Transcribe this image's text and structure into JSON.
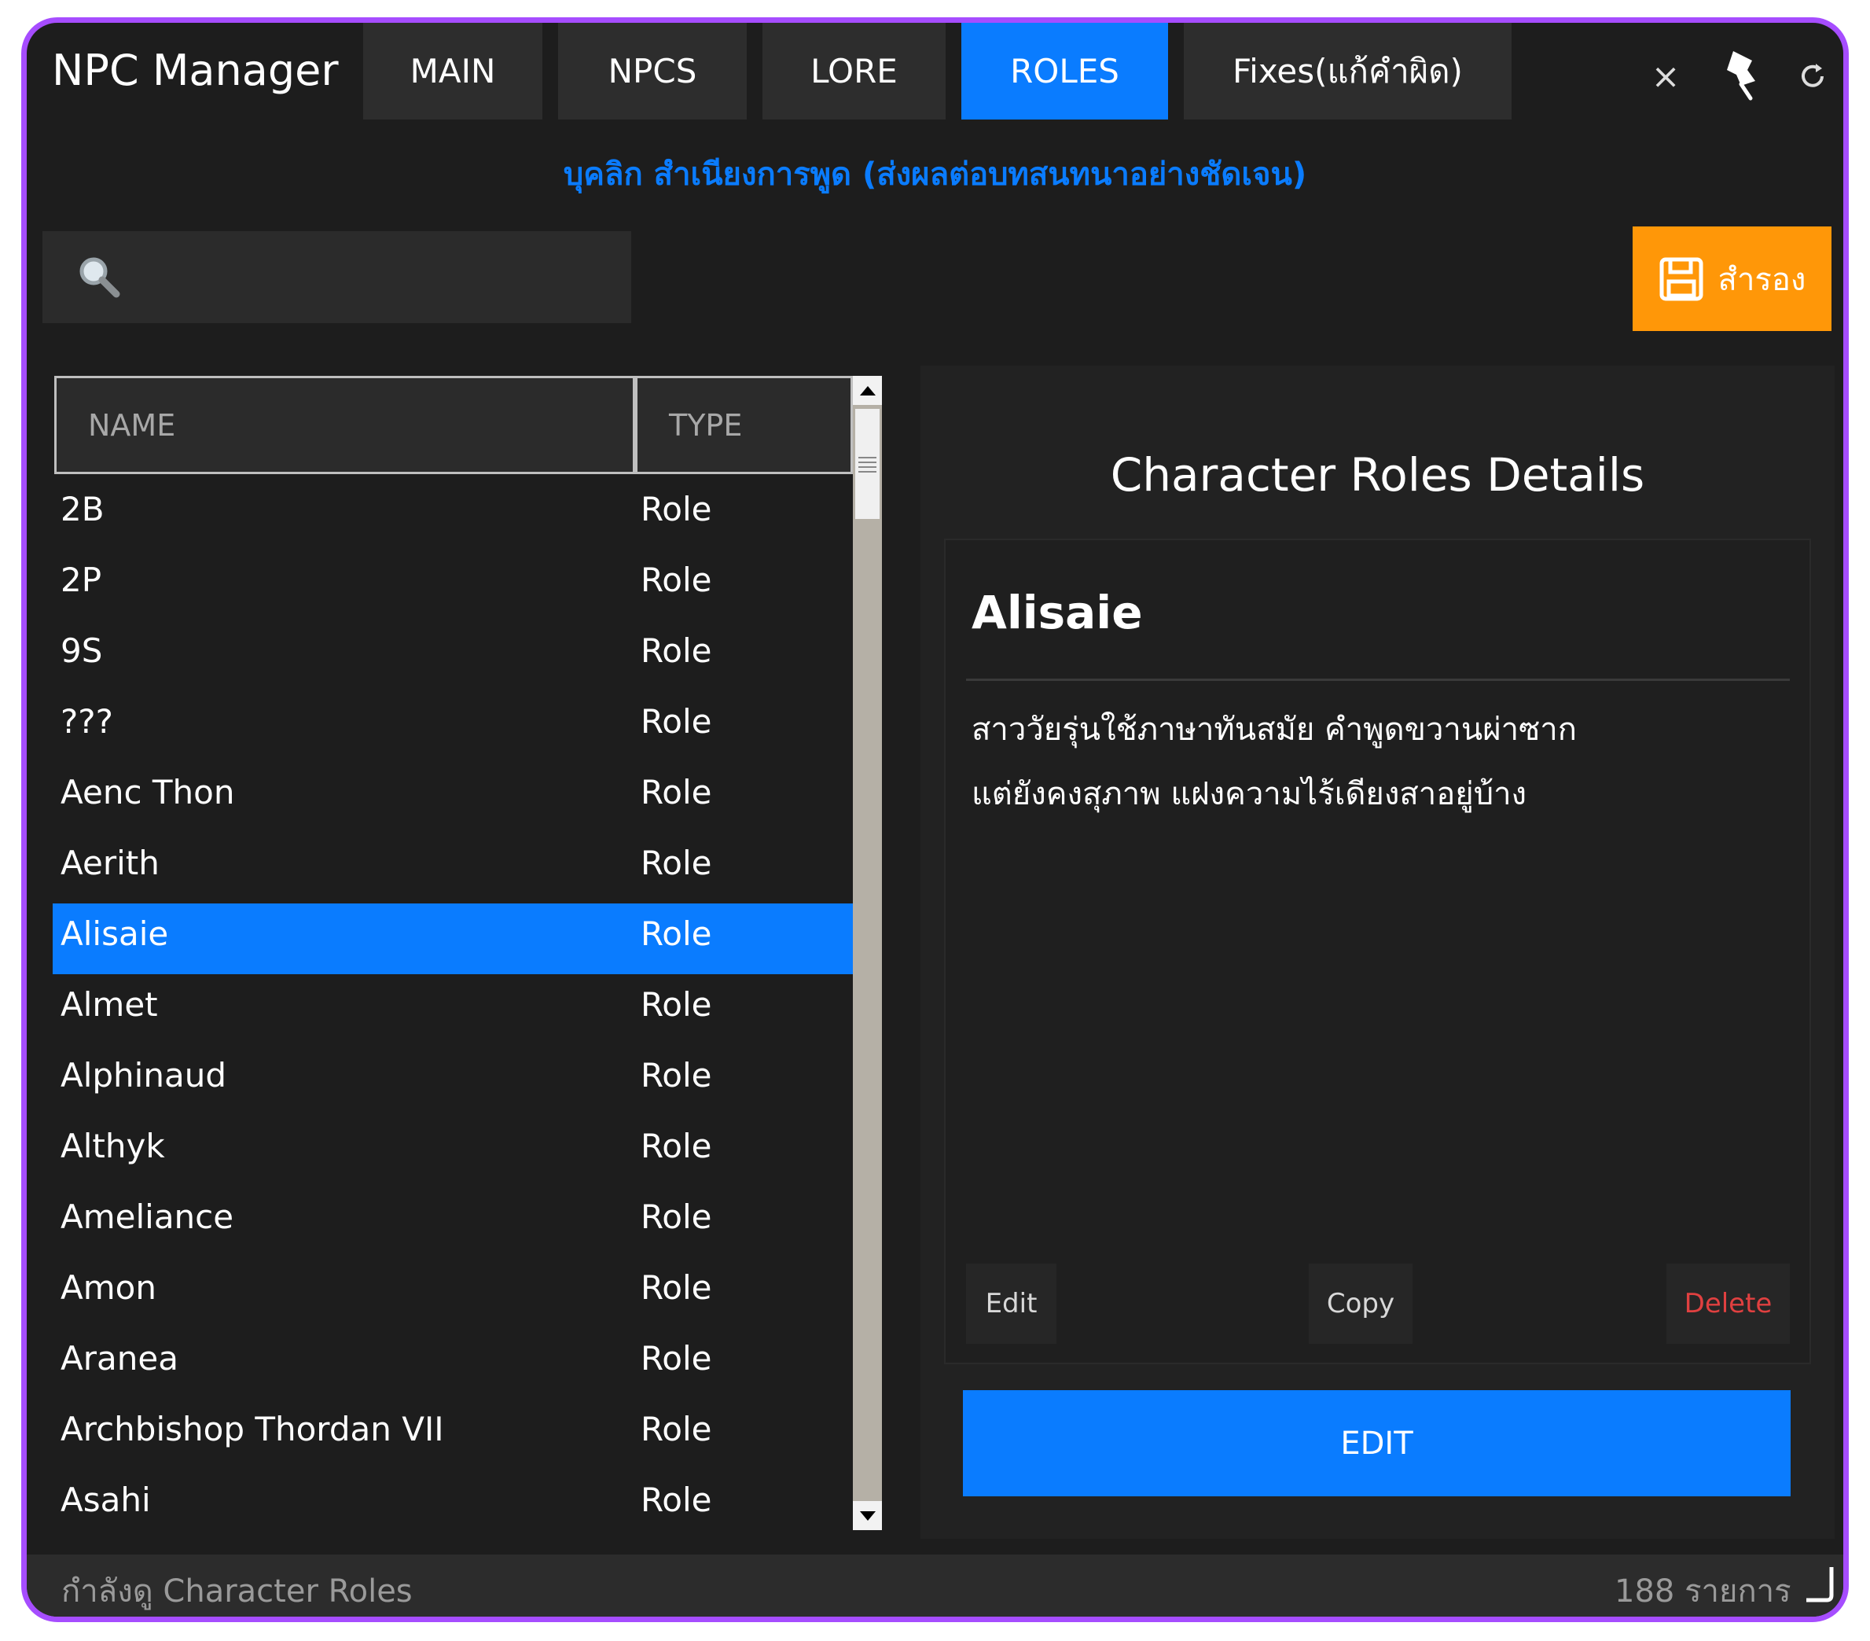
{
  "app": {
    "title": "NPC Manager",
    "tabs": [
      {
        "label": "MAIN"
      },
      {
        "label": "NPCS"
      },
      {
        "label": "LORE"
      },
      {
        "label": "ROLES",
        "active": true
      },
      {
        "label": "Fixes(แก้คำผิด)"
      }
    ],
    "close_glyph": "×"
  },
  "subtitle": "บุคลิก สำเนียงการพูด (ส่งผลต่อบทสนทนาอย่างชัดเจน)",
  "search": {
    "placeholder": "",
    "value": ""
  },
  "save_button": {
    "label": "สำรอง",
    "icon": "save-icon"
  },
  "table": {
    "headers": [
      "NAME",
      "TYPE"
    ],
    "rows": [
      {
        "name": "2B",
        "type": "Role"
      },
      {
        "name": "2P",
        "type": "Role"
      },
      {
        "name": "9S",
        "type": "Role"
      },
      {
        "name": "???",
        "type": "Role"
      },
      {
        "name": "Aenc Thon",
        "type": "Role"
      },
      {
        "name": "Aerith",
        "type": "Role"
      },
      {
        "name": "Alisaie",
        "type": "Role"
      },
      {
        "name": "Almet",
        "type": "Role"
      },
      {
        "name": "Alphinaud",
        "type": "Role"
      },
      {
        "name": "Althyk",
        "type": "Role"
      },
      {
        "name": "Ameliance",
        "type": "Role"
      },
      {
        "name": "Amon",
        "type": "Role"
      },
      {
        "name": "Aranea",
        "type": "Role"
      },
      {
        "name": "Archbishop Thordan VII",
        "type": "Role"
      },
      {
        "name": "Asahi",
        "type": "Role"
      }
    ],
    "selected_index": 6
  },
  "details": {
    "title": "Character Roles Details",
    "name": "Alisaie",
    "description_lines": [
      "สาววัยรุ่นใช้ภาษาทันสมัย คำพูดขวานผ่าซาก",
      "แต่ยังคงสุภาพ แฝงความไร้เดียงสาอยู่บ้าง"
    ],
    "buttons": {
      "edit": "Edit",
      "copy": "Copy",
      "delete": "Delete"
    },
    "edit_big": "EDIT"
  },
  "status": {
    "left": "กำลังดู Character Roles",
    "right": "188 รายการ"
  },
  "colors": {
    "accent": "#0a7cff",
    "save": "#ff9708",
    "delete": "#e04040",
    "border": "#a64dff"
  }
}
